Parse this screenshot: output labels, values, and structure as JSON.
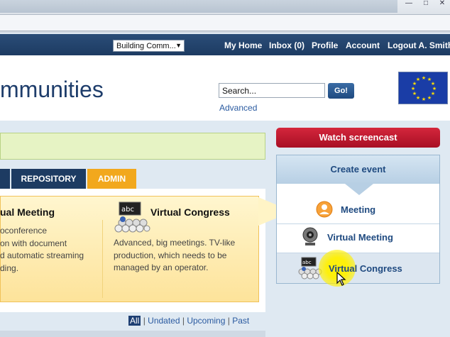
{
  "nav": {
    "community_select": "Building Comm...",
    "my_home": "My Home",
    "inbox": "Inbox (0)",
    "profile": "Profile",
    "account": "Account",
    "logout": "Logout A. Smith"
  },
  "header": {
    "title": "mmunities",
    "search_value": "Search...",
    "go_label": "Go!",
    "advanced_label": "Advanced"
  },
  "tabs": {
    "repository": "REPOSITORY",
    "admin": "ADMIN"
  },
  "cards": {
    "virtual_meeting": {
      "title": "ual Meeting",
      "line1": "oconference",
      "line2": "on with document",
      "line3": "d automatic streaming",
      "line4": "ding."
    },
    "virtual_congress": {
      "title": "Virtual Congress",
      "line1": "Advanced, big meetings. TV-like",
      "line2": "production, which needs to be",
      "line3": "managed by an operator."
    }
  },
  "filters": {
    "all": "All",
    "undated": "Undated",
    "upcoming": "Upcoming",
    "past": "Past",
    "separator": "|"
  },
  "sidebar": {
    "screencast_label": "Watch screencast",
    "create_event_label": "Create event",
    "items": [
      {
        "label": "Meeting",
        "icon": "person-icon"
      },
      {
        "label": "Virtual Meeting",
        "icon": "webcam-icon"
      },
      {
        "label": "Virtual Congress",
        "icon": "congress-icon"
      }
    ]
  },
  "colors": {
    "nav_bar": "#1d3b62",
    "admin_tab": "#f2a81d",
    "screencast": "#c41a31",
    "callout": "#fde39a"
  }
}
